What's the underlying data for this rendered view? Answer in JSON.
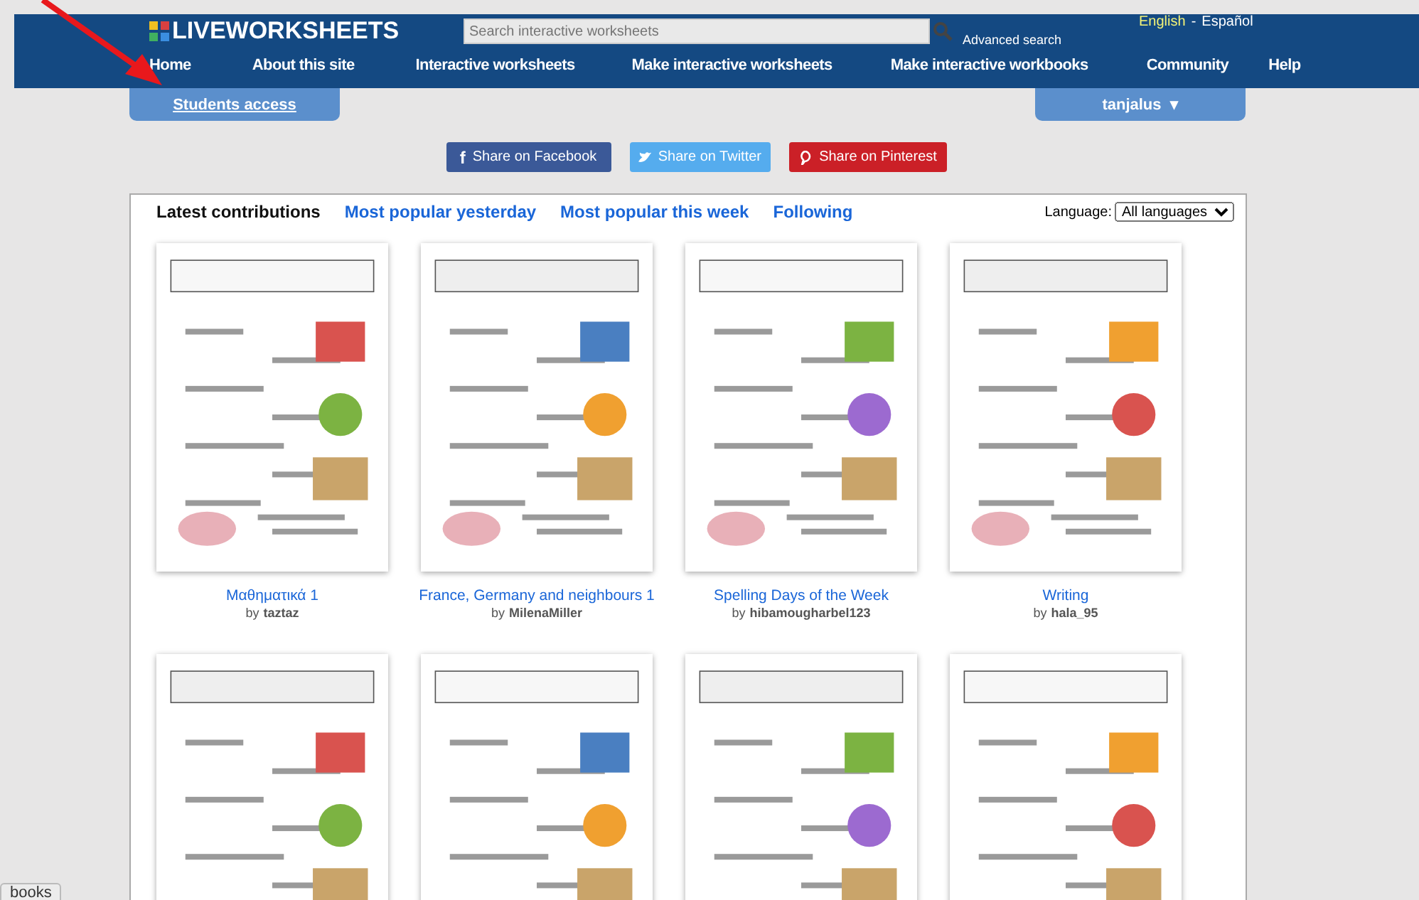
{
  "header": {
    "logo": "LIVEWORKSHEETS",
    "search": {
      "placeholder": "Search interactive worksheets"
    },
    "advanced_search": "Advanced search",
    "languages": [
      {
        "label": "English",
        "selected": true
      },
      {
        "label": "Español",
        "selected": false
      }
    ],
    "separator": "-"
  },
  "nav": [
    "Home",
    "About this site",
    "Interactive worksheets",
    "Make interactive worksheets",
    "Make interactive workbooks",
    "Community",
    "Help"
  ],
  "students_access": "Students access",
  "user_menu": {
    "label": "tanjalus",
    "caret": "▾"
  },
  "share": [
    {
      "kind": "facebook",
      "label": "Share on Facebook",
      "icon": "f"
    },
    {
      "kind": "twitter",
      "label": "Share on Twitter"
    },
    {
      "kind": "pinterest",
      "label": "Share on Pinterest"
    }
  ],
  "tabs": [
    {
      "label": "Latest contributions",
      "selected": true
    },
    {
      "label": "Most popular yesterday",
      "selected": false
    },
    {
      "label": "Most popular this week",
      "selected": false
    },
    {
      "label": "Following",
      "selected": false
    }
  ],
  "language_filter": {
    "label": "Language:",
    "value": "All languages"
  },
  "worksheets": [
    {
      "title": "Μαθηματικά 1",
      "by": "by",
      "author": "taztaz"
    },
    {
      "title": "France, Germany and neighbours 1",
      "by": "by",
      "author": "MilenaMiller"
    },
    {
      "title": "Spelling Days of the Week",
      "by": "by",
      "author": "hibamougharbel123"
    },
    {
      "title": "Writing",
      "by": "by",
      "author": "hala_95"
    }
  ],
  "side_tab": "books",
  "annotation": {
    "kind": "arrow"
  }
}
